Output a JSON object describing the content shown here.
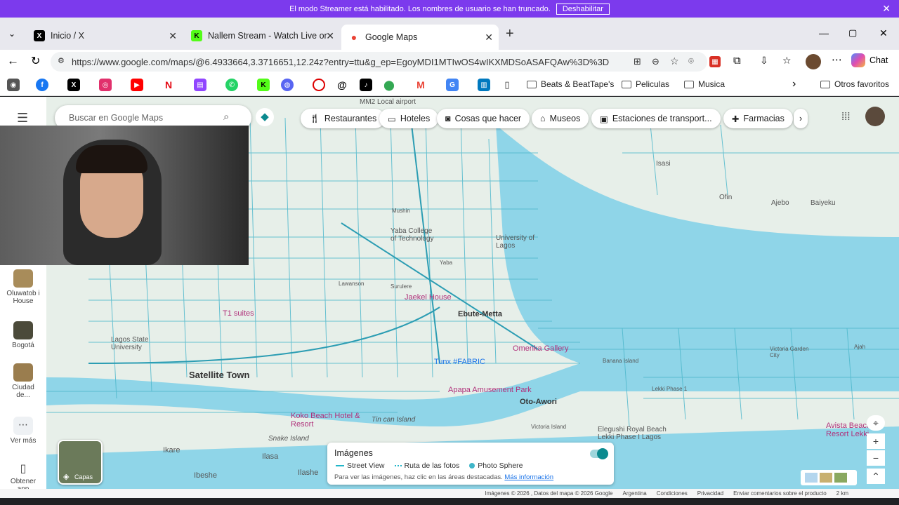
{
  "banner": {
    "text": "El modo Streamer está habilitado. Los nombres de usuario se han truncado.",
    "button": "Deshabilitar",
    "close": "✕"
  },
  "tabs": [
    {
      "title": "Inicio / X",
      "icon": "x-icon"
    },
    {
      "title": "Nallem Stream - Watch Live on Kic",
      "icon": "kick-icon"
    },
    {
      "title": "Google Maps",
      "icon": "google-maps-icon"
    }
  ],
  "toolbar": {
    "url": "https://www.google.com/maps/@6.4933664,3.3716651,12.24z?entry=ttu&g_ep=EgoyMDI1MTIwOS4wIKXMDSoASAFQAw%3D%3D",
    "chat_label": "Chat"
  },
  "bookmarks": {
    "folders": [
      "Beats & BeatTape's",
      "Peliculas",
      "Musica"
    ],
    "others": "Otros favoritos"
  },
  "maps": {
    "search_placeholder": "Buscar en Google Maps",
    "chips": [
      "Restaurantes",
      "Hoteles",
      "Cosas que hacer",
      "Museos",
      "Estaciones de transport...",
      "Farmacias"
    ],
    "rail": [
      {
        "label": "Oluwatob i House"
      },
      {
        "label": "Bogotá"
      },
      {
        "label": "Ciudad de..."
      },
      {
        "label": "Ver más"
      },
      {
        "label": "Obtener app"
      }
    ],
    "layers_label": "Capas",
    "places": [
      "Satellite Town",
      "Ebute-Metta",
      "Oto-Awori",
      "Ikare",
      "Ilasa",
      "Ilashe",
      "Ibeshe",
      "Isasi",
      "Ofin",
      "Ajebo",
      "Baiyeku",
      "Snake Island",
      "Tin can Island",
      "Lagos State University",
      "Yaba College of Technology",
      "University of Lagos",
      "Jaekel House",
      "Omenka Gallery",
      "Tunx #FABRIC",
      "Apapa Amusement Park",
      "Koko Beach Hotel & Resort",
      "T1 suites",
      "Elegushi Royal Beach Lekki Phase I Lagos",
      "Avista Beach Resort Lekki",
      "MM2 Local airport",
      "Banana Island",
      "Lekki Phase 1",
      "Victoria Island",
      "Victoria Garden City",
      "Lawanson",
      "Surulere",
      "Yaba",
      "Mushin",
      "Ajah"
    ],
    "images_panel": {
      "title": "Imágenes",
      "legend": [
        "Street View",
        "Ruta de las fotos",
        "Photo Sphere"
      ],
      "hint": "Para ver las imágenes, haz clic en las áreas destacadas.",
      "link": "Más información"
    },
    "footer": [
      "Imágenes © 2026 , Datos del mapa © 2026 Google",
      "Argentina",
      "Condiciones",
      "Privacidad",
      "Enviar comentarios sobre el producto",
      "2 km"
    ]
  }
}
